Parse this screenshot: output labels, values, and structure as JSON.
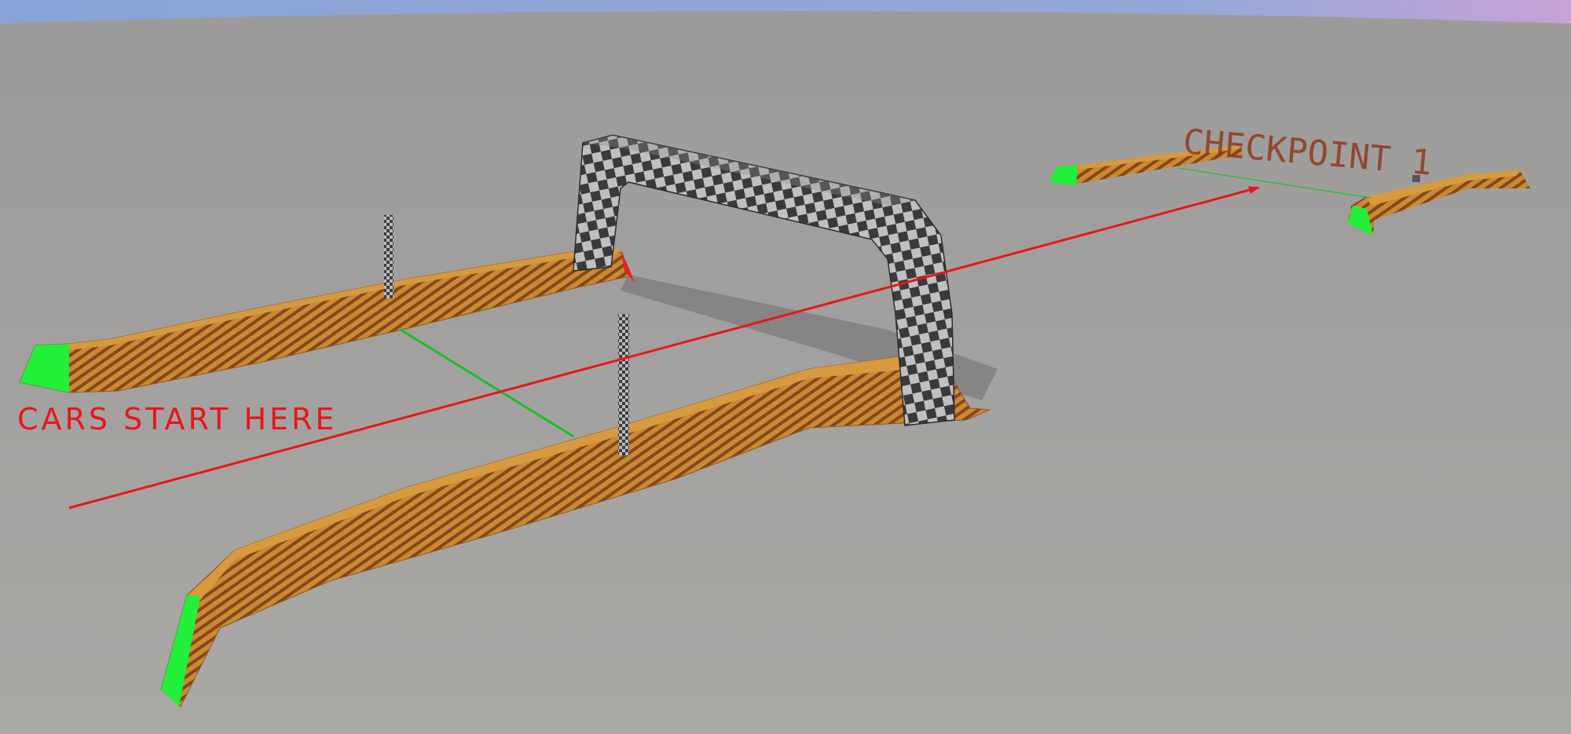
{
  "annotations": {
    "start_label": "CARS START HERE",
    "checkpoint_label": "CHECKPOINT 1"
  },
  "colors": {
    "sky_top": "#8ba7d8",
    "ground": "#a3a2a0",
    "barrier_orange": "#c98a32",
    "barrier_stripe": "#7a3a1a",
    "barrier_end_green": "#22f03a",
    "barrier_end_red": "#e32222",
    "arch_check_dark": "#3a3a3c",
    "arch_check_light": "#bfc0c2",
    "gate_line_green": "#1bbf24",
    "direction_arrow": "#e8161a",
    "annotation_red": "#e8161a",
    "checkpoint_text": "#8f3a21"
  },
  "scene_objects": {
    "start_gate": [
      "left-barrier",
      "right-barrier",
      "finish-arch",
      "gate-poles"
    ],
    "checkpoint_1": [
      "left-barrier",
      "right-barrier"
    ],
    "direction": "arrow-toward-checkpoint-1"
  }
}
